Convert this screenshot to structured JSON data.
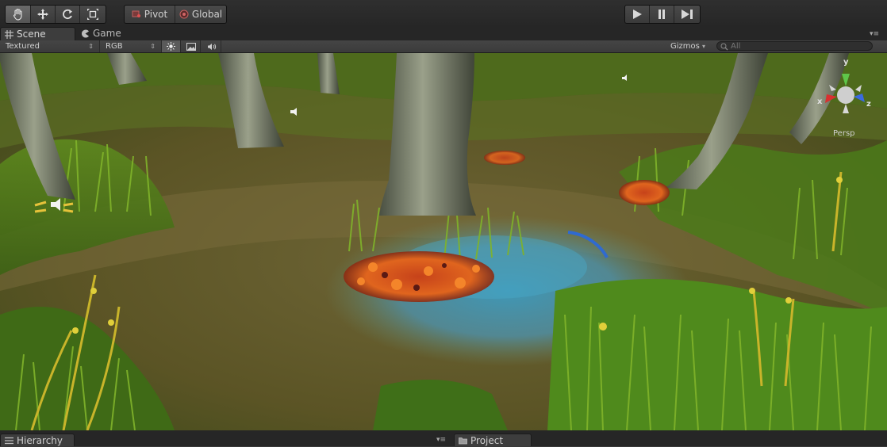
{
  "toolbar": {
    "tools": [
      {
        "icon": "hand-icon",
        "active": true
      },
      {
        "icon": "move-icon",
        "active": false
      },
      {
        "icon": "rotate-icon",
        "active": false
      },
      {
        "icon": "scale-icon",
        "active": false
      }
    ],
    "pivot_label": "Pivot",
    "global_label": "Global",
    "play": {
      "play_icon": "play-icon",
      "pause_icon": "pause-icon",
      "step_icon": "step-icon"
    }
  },
  "tabs": [
    {
      "label": "Scene",
      "icon": "scene-grid-icon",
      "active": true
    },
    {
      "label": "Game",
      "icon": "game-pacman-icon",
      "active": false
    }
  ],
  "scenebar": {
    "draw_mode": "Textured",
    "render_mode": "RGB",
    "lighting_icon": "sun-icon",
    "fx_icon": "image-icon",
    "audio_icon": "audio-icon",
    "gizmos_label": "Gizmos",
    "search_placeholder": "All"
  },
  "viewport": {
    "gizmo_axes": {
      "x": "x",
      "y": "y",
      "z": "z"
    },
    "projection_label": "Persp"
  },
  "bottom": {
    "hierarchy_label": "Hierarchy",
    "project_label": "Project"
  },
  "colors": {
    "toolbar_bg": "#2b2b2b",
    "panel_bg": "#3d3d3d",
    "axis_x": "#d93030",
    "axis_y": "#5fc64a",
    "axis_z": "#3a6ae0"
  }
}
